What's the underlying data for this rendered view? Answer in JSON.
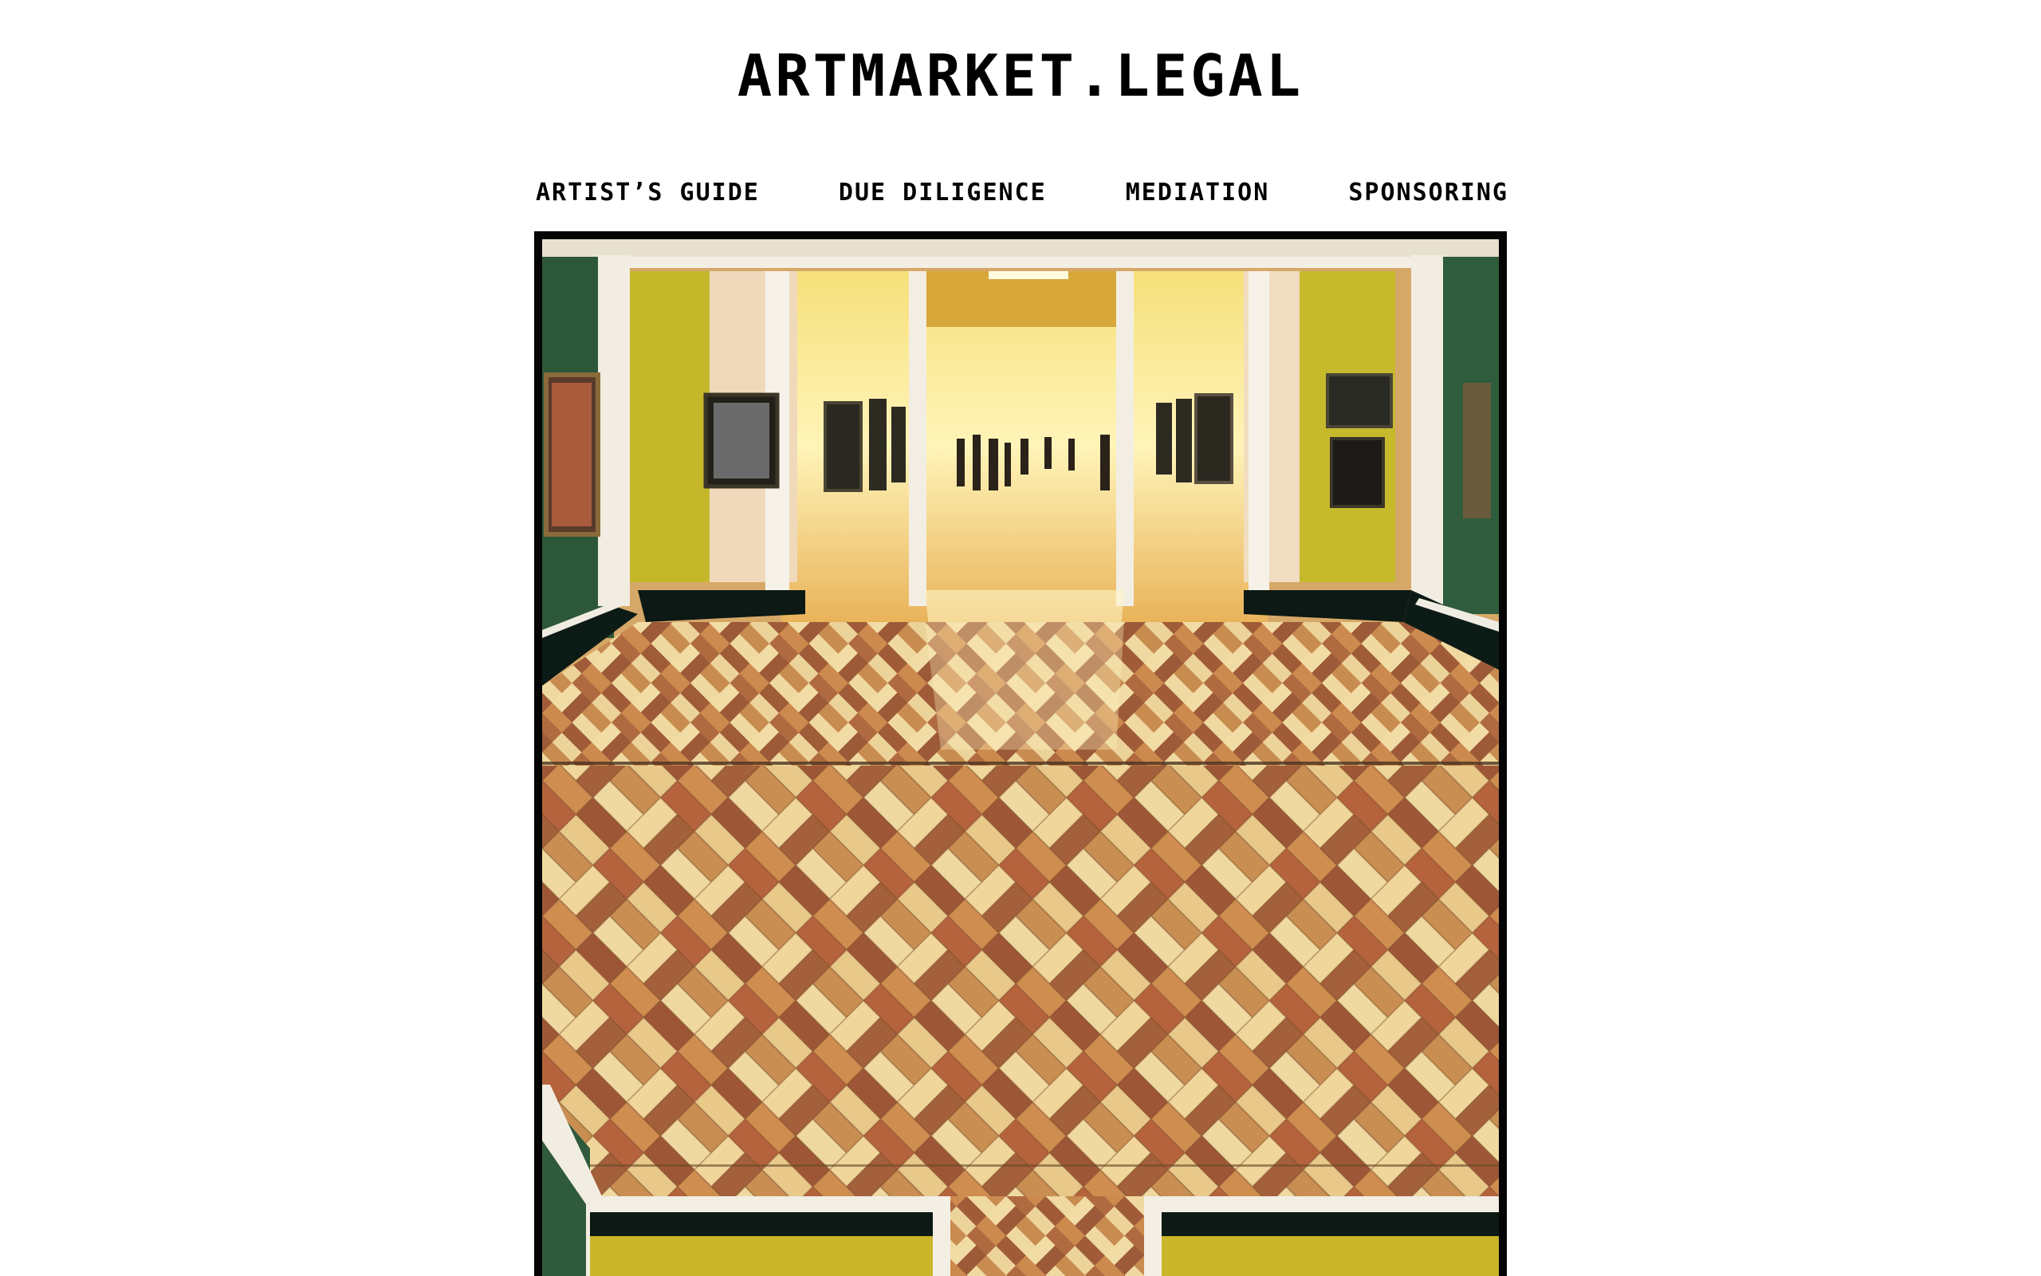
{
  "header": {
    "site_title": "ARTMARKET.LEGAL"
  },
  "nav": {
    "items": [
      {
        "label": "ARTIST’S GUIDE"
      },
      {
        "label": "DUE DILIGENCE"
      },
      {
        "label": "MEDIATION"
      },
      {
        "label": "SPONSORING"
      }
    ]
  },
  "hero": {
    "image_subject": "museum gallery rooms with herringbone parquet floor",
    "colors": {
      "green_wall": "#2f5a3a",
      "yellow_wall": "#c8b92a",
      "cream_wall": "#f1dcc0",
      "trim": "#f3efe6",
      "baseboard": "#0c1a16",
      "frame_border": "#050505"
    }
  }
}
